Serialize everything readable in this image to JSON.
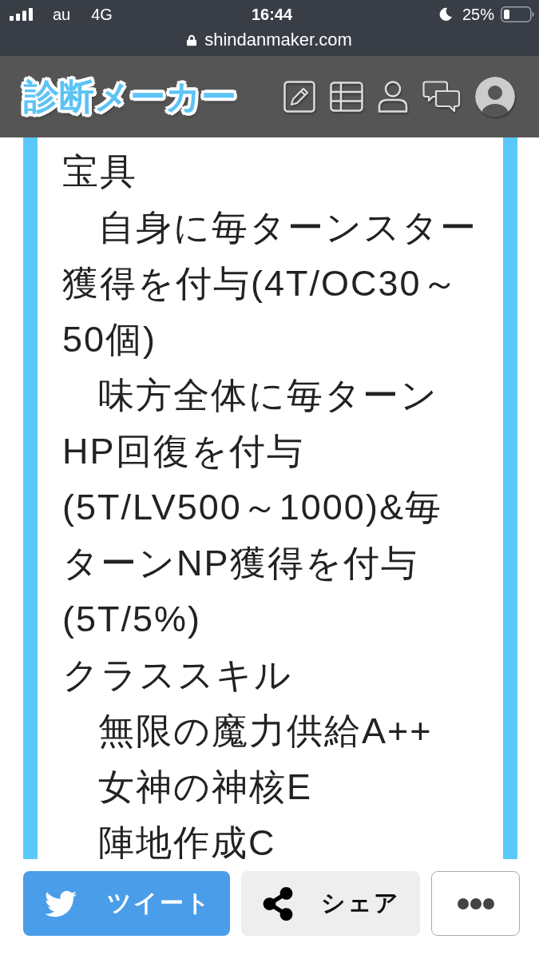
{
  "status_bar": {
    "carrier": "au",
    "network": "4G",
    "time": "16:44",
    "battery": "25%",
    "url": "shindanmaker.com"
  },
  "header": {
    "logo": "診断メーカー"
  },
  "result": {
    "lines": [
      {
        "text": "宝具",
        "indented": false
      },
      {
        "text": "自身に毎ターンスター獲得を付与(4T/OC30～50個)",
        "indented": true
      },
      {
        "text": "味方全体に毎ターンHP回復を付与(5T/LV500～1000)&毎ターンNP獲得を付与(5T/5%)",
        "indented": true
      },
      {
        "text": "クラススキル",
        "indented": false
      },
      {
        "text": "無限の魔力供給A++",
        "indented": true
      },
      {
        "text": "女神の神核E",
        "indented": true
      },
      {
        "text": "陣地作成C",
        "indented": true
      }
    ]
  },
  "actions": [
    {
      "kind": "tweet",
      "label": "ツイート"
    },
    {
      "kind": "share",
      "label": "シェア"
    },
    {
      "kind": "more"
    }
  ]
}
